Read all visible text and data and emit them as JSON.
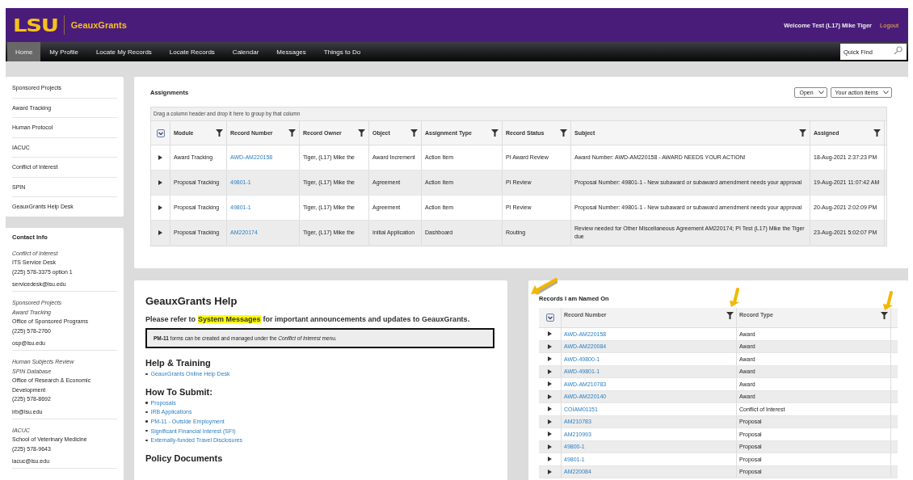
{
  "header": {
    "logo": "LSU",
    "app_name": "GeauxGrants",
    "welcome": "Welcome Test (L17) Mike Tiger",
    "logout": "Logout"
  },
  "nav": {
    "items": [
      {
        "label": "Home",
        "selected": true
      },
      {
        "label": "My Profile",
        "selected": false
      },
      {
        "label": "Locate My Records",
        "selected": false
      },
      {
        "label": "Locate Records",
        "selected": false
      },
      {
        "label": "Calendar",
        "selected": false
      },
      {
        "label": "Messages",
        "selected": false
      },
      {
        "label": "Things to Do",
        "selected": false
      }
    ],
    "quick_find": {
      "placeholder": "Quick Find"
    }
  },
  "sidebar": {
    "items": [
      "Sponsored Projects",
      "Award Tracking",
      "Human Protocol",
      "IACUC",
      "Conflict of Interest",
      "SPIN",
      "GeauxGrants Help Desk"
    ]
  },
  "contact_info": {
    "title": "Contact Info",
    "groups": [
      {
        "topics": [
          "Conflict of Interest"
        ],
        "lines": [
          "ITS Service Desk",
          "(225) 578-3375 option 1"
        ],
        "email": "servicedesk@lsu.edu"
      },
      {
        "topics": [
          "Sponsored Projects",
          "Award Tracking"
        ],
        "lines": [
          "Office of Sponsored Programs",
          "(225) 578-2760"
        ],
        "email": "osp@lsu.edu"
      },
      {
        "topics": [
          "Human Subjects Review",
          "SPIN Database"
        ],
        "lines": [
          "Office of Research & Economic Development",
          "(225) 578-8692"
        ],
        "email": "irb@lsu.edu"
      },
      {
        "topics": [
          "IACUC"
        ],
        "lines": [
          "School of Veterinary Medicine",
          "(225) 578-9643"
        ],
        "email": "iacuc@lsu.edu"
      }
    ]
  },
  "assignments": {
    "title": "Assignments",
    "filters": [
      "Open",
      "Your action items"
    ],
    "group_hint": "Drag a column header and drop it here to group by that column",
    "columns": [
      "Module",
      "Record Number",
      "Record Owner",
      "Object",
      "Assignment Type",
      "Record Status",
      "Subject",
      "Assigned"
    ],
    "rows": [
      {
        "module": "Award Tracking",
        "record_number": "AWD-AM220158",
        "record_owner": "Tiger, (L17) Mike the",
        "object": "Award Increment",
        "assignment_type": "Action Item",
        "record_status": "PI Award Review",
        "subject": "Award Number: AWD-AM220158 - AWARD NEEDS YOUR ACTION!",
        "assigned": "18-Aug-2021 2:37:23 PM"
      },
      {
        "module": "Proposal Tracking",
        "record_number": "49801-1",
        "record_owner": "Tiger, (L17) Mike the",
        "object": "Agreement",
        "assignment_type": "Action Item",
        "record_status": "PI Review",
        "subject": "Proposal Number: 49801-1 - New subaward or subaward amendment needs your approval",
        "assigned": "19-Aug-2021 11:07:42 AM"
      },
      {
        "module": "Proposal Tracking",
        "record_number": "49801-1",
        "record_owner": "Tiger, (L17) Mike the",
        "object": "Agreement",
        "assignment_type": "Action Item",
        "record_status": "PI Review",
        "subject": "Proposal Number: 49801-1 - New subaward or subaward amendment needs your approval",
        "assigned": "20-Aug-2021 2:02:09 PM"
      },
      {
        "module": "Proposal Tracking",
        "record_number": "AM220174",
        "record_owner": "Tiger, (L17) Mike the",
        "object": "Initial Application",
        "assignment_type": "Dashboard",
        "record_status": "Routing",
        "subject": "Review needed for Other Miscellaneous Agreement AM220174; PI Test (L17) Mike the Tiger due",
        "assigned": "23-Aug-2021 5:02:07 PM"
      }
    ]
  },
  "help": {
    "title": "GeauxGrants Help",
    "intro_before": "Please refer to",
    "intro_highlight": "System Messages",
    "intro_after": "for important announcements and updates to GeauxGrants.",
    "notice": "**PM-11** forms can be created and managed under the *Conflict of Interest* menu.",
    "sections": [
      {
        "heading": "Help & Training",
        "links": [
          "GeauxGrants Online Help Desk"
        ]
      },
      {
        "heading": "How To Submit:",
        "links": [
          "Proposals",
          "IRB Applications",
          "PM-11 - Outside Employment",
          "Significant Financial Interest (SFI)",
          "Externally-funded Travel Disclosures"
        ]
      },
      {
        "heading": "Policy Documents"
      }
    ]
  },
  "records": {
    "title": "Records I am Named On",
    "columns": [
      "Record Number",
      "Record Type"
    ],
    "rows": [
      {
        "record_number": "AWD-AM220158",
        "record_type": "Award"
      },
      {
        "record_number": "AWD-AM220084",
        "record_type": "Award"
      },
      {
        "record_number": "AWD-49800-1",
        "record_type": "Award"
      },
      {
        "record_number": "AWD-49801-1",
        "record_type": "Award"
      },
      {
        "record_number": "AWD-AM210783",
        "record_type": "Award"
      },
      {
        "record_number": "AWD-AM220140",
        "record_type": "Award"
      },
      {
        "record_number": "COIAM01151",
        "record_type": "Conflict of Interest"
      },
      {
        "record_number": "AM210783",
        "record_type": "Proposal"
      },
      {
        "record_number": "AM210993",
        "record_type": "Proposal"
      },
      {
        "record_number": "49800-1",
        "record_type": "Proposal"
      },
      {
        "record_number": "49801-1",
        "record_type": "Proposal"
      },
      {
        "record_number": "AM220084",
        "record_type": "Proposal"
      }
    ]
  }
}
